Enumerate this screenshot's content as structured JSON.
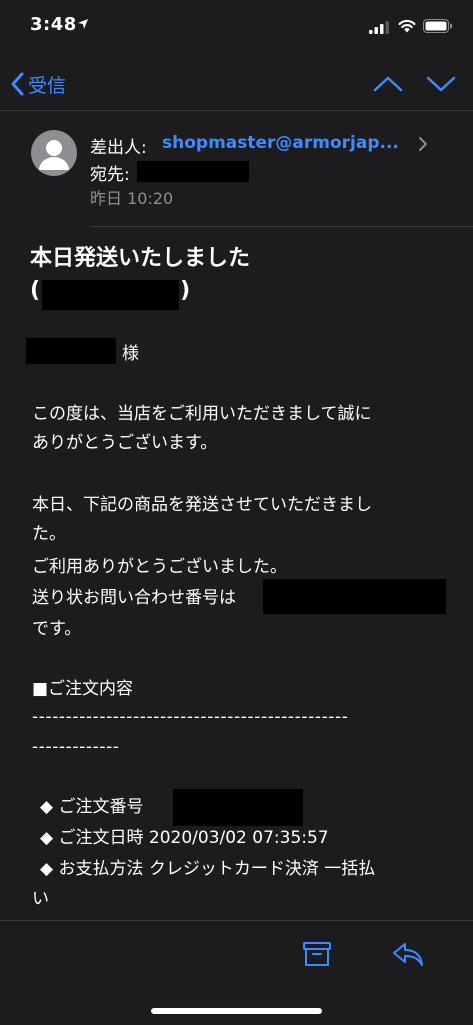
{
  "status": {
    "time": "3:48"
  },
  "nav": {
    "back_label": "受信"
  },
  "header": {
    "from_label": "差出人:",
    "from_value": "shopmaster@armorjap...",
    "to_label": "宛先:",
    "date": "昨日 10:20"
  },
  "body": {
    "subject_line1": "本日発送いたしました",
    "subject_open": "(",
    "subject_close": ")",
    "honorific": "様",
    "para1_line1": "この度は、当店をご利用いただきまして誠に",
    "para1_line2": "ありがとうございます。",
    "para2_line1": "本日、下記の商品を発送させていただきまし",
    "para2_line2": "た。",
    "para2_line3": "ご利用ありがとうございました。",
    "para2_line4": "送り状お問い合わせ番号は",
    "para2_line5": "です。",
    "section_title": "■ご注文内容",
    "dashes_line1": "-----------------------------------------------",
    "dashes_line2": "-------------",
    "order_number_label": "◆ ご注文番号",
    "order_date_label": "◆ ご注文日時 2020/03/02 07:35:57",
    "payment_label": "◆ お支払方法 クレジットカード決済 一括払",
    "payment_cont": "い"
  },
  "colors": {
    "accent": "#3e8bff",
    "background": "#1c1c1e",
    "secondary_text": "#8e8e93"
  },
  "icons": [
    "location-arrow-icon",
    "cellular-signal-icon",
    "wifi-icon",
    "battery-icon",
    "chevron-left-icon",
    "chevron-up-icon",
    "chevron-down-icon",
    "person-avatar-icon",
    "chevron-right-icon",
    "archive-icon",
    "reply-icon"
  ]
}
